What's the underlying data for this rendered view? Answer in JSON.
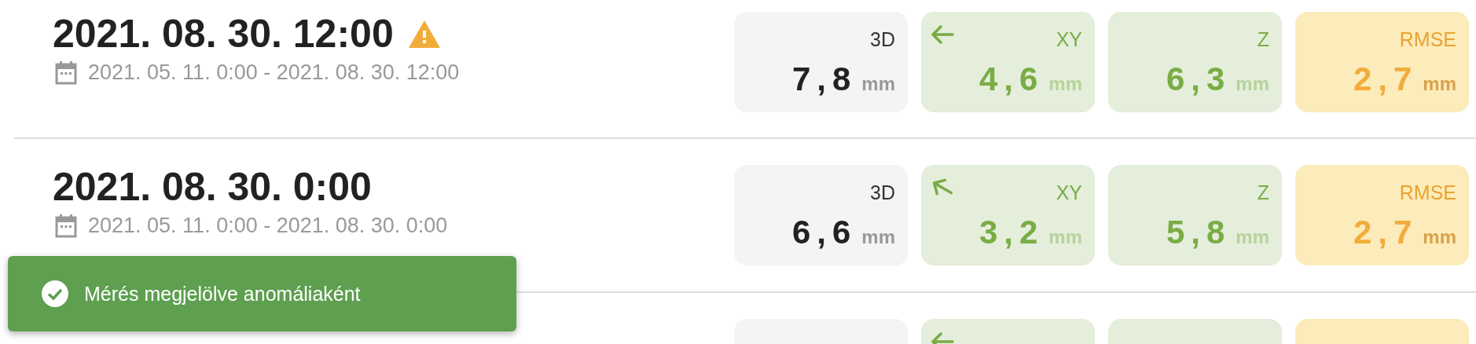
{
  "rows": [
    {
      "title": "2021. 08. 30. 12:00",
      "warning": true,
      "range": "2021. 05. 11. 0:00 - 2021. 08. 30. 12:00",
      "cards": [
        {
          "kind": "total",
          "label": "3D",
          "value": "7,8",
          "unit": "mm"
        },
        {
          "kind": "xy",
          "label": "XY",
          "value": "4,6",
          "unit": "mm",
          "arrow": {
            "kind": "left"
          }
        },
        {
          "kind": "z",
          "label": "Z",
          "value": "6,3",
          "unit": "mm"
        },
        {
          "kind": "rmse",
          "label": "RMSE",
          "value": "2,7",
          "unit": "mm"
        }
      ]
    },
    {
      "title": "2021. 08. 30. 0:00",
      "warning": false,
      "range": "2021. 05. 11. 0:00 - 2021. 08. 30. 0:00",
      "cards": [
        {
          "kind": "total",
          "label": "3D",
          "value": "6,6",
          "unit": "mm"
        },
        {
          "kind": "xy",
          "label": "XY",
          "value": "3,2",
          "unit": "mm",
          "arrow": {
            "kind": "up-left"
          }
        },
        {
          "kind": "z",
          "label": "Z",
          "value": "5,8",
          "unit": "mm"
        },
        {
          "kind": "rmse",
          "label": "RMSE",
          "value": "2,7",
          "unit": "mm"
        }
      ]
    },
    {
      "cards": [
        {
          "kind": "total"
        },
        {
          "kind": "xy",
          "arrow": {
            "kind": "left"
          }
        },
        {
          "kind": "z"
        },
        {
          "kind": "rmse"
        }
      ]
    }
  ],
  "toast": {
    "message": "Mérés megjelölve anomáliaként"
  }
}
